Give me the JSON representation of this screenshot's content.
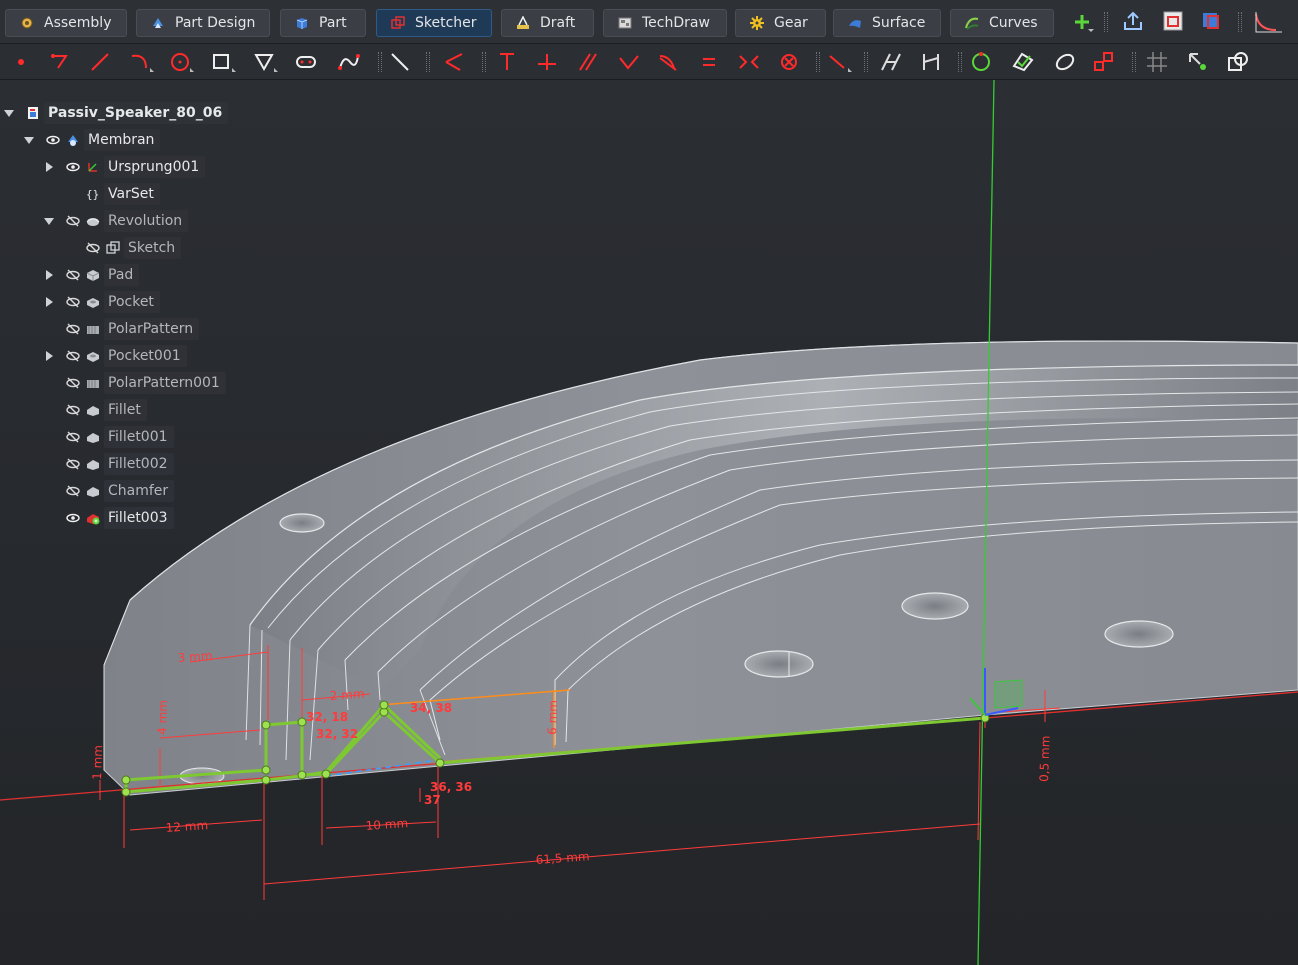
{
  "workbenches": [
    {
      "label": "Assembly",
      "icon": "assembly-icon"
    },
    {
      "label": "Part Design",
      "icon": "part-design-icon"
    },
    {
      "label": "Part",
      "icon": "part-icon"
    },
    {
      "label": "Sketcher",
      "icon": "sketcher-icon",
      "active": true
    },
    {
      "label": "Draft",
      "icon": "draft-icon"
    },
    {
      "label": "TechDraw",
      "icon": "techdraw-icon"
    },
    {
      "label": "Gear",
      "icon": "gear-icon"
    },
    {
      "label": "Surface",
      "icon": "surface-icon"
    },
    {
      "label": "Curves",
      "icon": "curves-icon"
    }
  ],
  "tree": {
    "root": "Passiv_Speaker_80_06",
    "items": [
      {
        "label": "Membran",
        "icon": "body-icon",
        "visible": true
      },
      {
        "label": "Ursprung001",
        "icon": "origin-icon",
        "visible": true
      },
      {
        "label": "VarSet",
        "icon": "varset-icon"
      },
      {
        "label": "Revolution",
        "icon": "revolution-icon",
        "visible": false
      },
      {
        "label": "Sketch",
        "icon": "sketch-icon",
        "visible": false
      },
      {
        "label": "Pad",
        "icon": "pad-icon",
        "visible": false
      },
      {
        "label": "Pocket",
        "icon": "pocket-icon",
        "visible": false
      },
      {
        "label": "PolarPattern",
        "icon": "polar-pattern-icon",
        "visible": false
      },
      {
        "label": "Pocket001",
        "icon": "pocket-icon",
        "visible": false
      },
      {
        "label": "PolarPattern001",
        "icon": "polar-pattern-icon",
        "visible": false
      },
      {
        "label": "Fillet",
        "icon": "fillet-icon",
        "visible": false
      },
      {
        "label": "Fillet001",
        "icon": "fillet-icon",
        "visible": false
      },
      {
        "label": "Fillet002",
        "icon": "fillet-icon",
        "visible": false
      },
      {
        "label": "Chamfer",
        "icon": "chamfer-icon",
        "visible": false
      },
      {
        "label": "Fillet003",
        "icon": "fillet-tip-icon",
        "visible": true
      }
    ]
  },
  "dimensions": {
    "d3mm": "3 mm",
    "d2mm": "2 mm",
    "d4mm": "4 mm",
    "d1mm": "1 mm",
    "d6mm": "6 mm",
    "d12mm": "12 mm",
    "d10mm": "10 mm",
    "d615mm": "61,5 mm",
    "d05mm": "0,5 mm",
    "c1": "32, 18",
    "c2": "32, 32",
    "c3": "34, 38",
    "c4": "36, 36",
    "c5": "37"
  },
  "colors": {
    "accent": "#1f3a57",
    "sketch_green": "#7ec832",
    "constraint_red": "#ff3b3b",
    "construction_orange": "#ff8c1a",
    "axis_green": "#33cc33",
    "axis_red": "#e03030"
  }
}
